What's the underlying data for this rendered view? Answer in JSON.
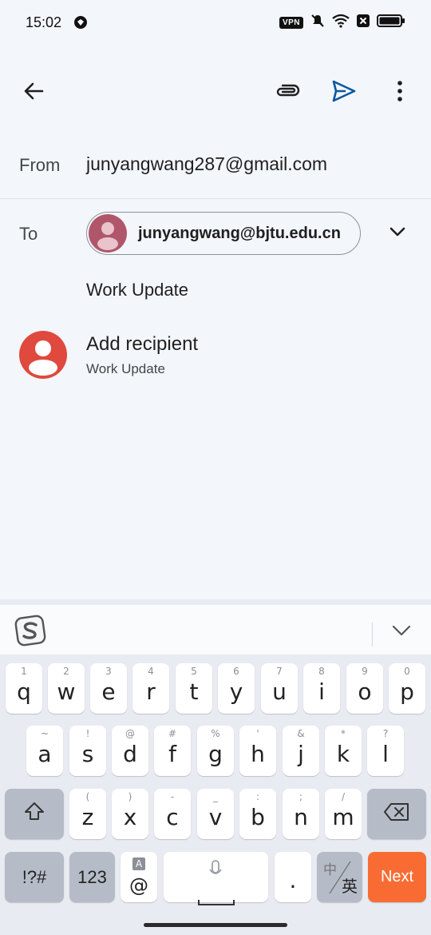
{
  "status_bar": {
    "time": "15:02",
    "vpn_label": "VPN"
  },
  "toolbar": {
    "back_icon": "arrow-left",
    "attach_icon": "paperclip",
    "send_icon": "send",
    "more_icon": "more-vertical",
    "accent_color": "#0b57a0"
  },
  "compose": {
    "from_label": "From",
    "from_value": "junyangwang287@gmail.com",
    "to_label": "To",
    "to_chip": "junyangwang@bjtu.edu.cn",
    "subject": "Work Update",
    "suggestion": {
      "title": "Add recipient",
      "subtitle": "Work Update",
      "avatar_color": "#e0493e"
    }
  },
  "keyboard": {
    "brand_icon": "sogou-s",
    "row1": [
      {
        "hint": "1",
        "key": "q"
      },
      {
        "hint": "2",
        "key": "w"
      },
      {
        "hint": "3",
        "key": "e"
      },
      {
        "hint": "4",
        "key": "r"
      },
      {
        "hint": "5",
        "key": "t"
      },
      {
        "hint": "6",
        "key": "y"
      },
      {
        "hint": "7",
        "key": "u"
      },
      {
        "hint": "8",
        "key": "i"
      },
      {
        "hint": "9",
        "key": "o"
      },
      {
        "hint": "0",
        "key": "p"
      }
    ],
    "row2": [
      {
        "hint": "~",
        "key": "a"
      },
      {
        "hint": "!",
        "key": "s"
      },
      {
        "hint": "@",
        "key": "d"
      },
      {
        "hint": "#",
        "key": "f"
      },
      {
        "hint": "%",
        "key": "g"
      },
      {
        "hint": "'",
        "key": "h"
      },
      {
        "hint": "&",
        "key": "j"
      },
      {
        "hint": "*",
        "key": "k"
      },
      {
        "hint": "?",
        "key": "l"
      }
    ],
    "row3": [
      {
        "hint": "(",
        "key": "z"
      },
      {
        "hint": ")",
        "key": "x"
      },
      {
        "hint": "-",
        "key": "c"
      },
      {
        "hint": "_",
        "key": "v"
      },
      {
        "hint": ":",
        "key": "b"
      },
      {
        "hint": ";",
        "key": "n"
      },
      {
        "hint": "/",
        "key": "m"
      }
    ],
    "symbols_label": "!?#",
    "numbers_label": "123",
    "at_hint": "A",
    "at_label": "@",
    "period_label": ".",
    "lang_top": "中",
    "lang_bottom": "英",
    "next_label": "Next",
    "next_color": "#f86c33"
  }
}
